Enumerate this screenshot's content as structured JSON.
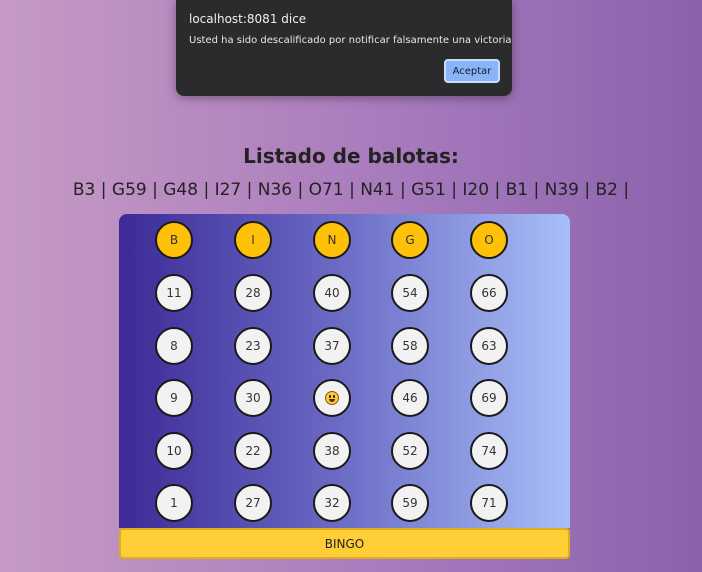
{
  "alert": {
    "title": "localhost:8081 dice",
    "message": "Usted ha sido descalificado por notificar falsamente una victoria",
    "ok_label": "Aceptar"
  },
  "heading": "Listado de balotas:",
  "called_balls": "B3 | G59 | G48 | I27 | N36 | O71 | N41 | G51 | I20 | B1 | N39 | B2 |",
  "board": {
    "headers": [
      "B",
      "I",
      "N",
      "G",
      "O"
    ],
    "rows": [
      [
        "11",
        "28",
        "40",
        "54",
        "66"
      ],
      [
        "8",
        "23",
        "37",
        "58",
        "63"
      ],
      [
        "9",
        "30",
        "",
        "46",
        "69"
      ],
      [
        "10",
        "22",
        "38",
        "52",
        "74"
      ],
      [
        "1",
        "27",
        "32",
        "59",
        "71"
      ]
    ],
    "free_icon": "smiley-icon"
  },
  "bingo_label": "BINGO",
  "colors": {
    "header_ball": "#ffc107",
    "bingo_button": "#ffcd36",
    "dialog_bg": "#2b2b2d",
    "dialog_button": "#8ab4f8"
  }
}
